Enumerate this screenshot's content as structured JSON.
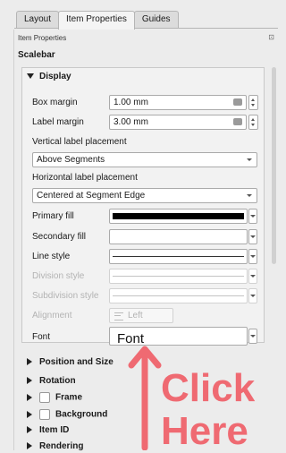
{
  "tabs": [
    {
      "label": "Layout"
    },
    {
      "label": "Item Properties"
    },
    {
      "label": "Guides"
    }
  ],
  "pane_title": "Item Properties",
  "pane_icon": "dock-icon",
  "section_title": "Scalebar",
  "display": {
    "header": "Display",
    "box_margin": {
      "label": "Box margin",
      "value": "1.00 mm"
    },
    "label_margin": {
      "label": "Label margin",
      "value": "3.00 mm"
    },
    "vertical_label_placement": {
      "label": "Vertical label placement",
      "value": "Above Segments"
    },
    "horizontal_label_placement": {
      "label": "Horizontal label placement",
      "value": "Centered at Segment Edge"
    },
    "primary_fill": {
      "label": "Primary fill",
      "color": "#000000"
    },
    "secondary_fill": {
      "label": "Secondary fill",
      "color": "#ffffff"
    },
    "line_style": {
      "label": "Line style"
    },
    "division_style": {
      "label": "Division style"
    },
    "subdivision_style": {
      "label": "Subdivision style"
    },
    "alignment": {
      "label": "Alignment",
      "value": "Left"
    },
    "font": {
      "label": "Font",
      "value": "Font"
    }
  },
  "collapsed_sections": [
    {
      "label": "Position and Size",
      "checkbox": false
    },
    {
      "label": "Rotation",
      "checkbox": false
    },
    {
      "label": "Frame",
      "checkbox": true
    },
    {
      "label": "Background",
      "checkbox": true
    },
    {
      "label": "Item ID",
      "checkbox": false
    },
    {
      "label": "Rendering",
      "checkbox": false
    }
  ],
  "annotation": {
    "line1": "Click",
    "line2": "Here",
    "color": "#ef6a72"
  }
}
